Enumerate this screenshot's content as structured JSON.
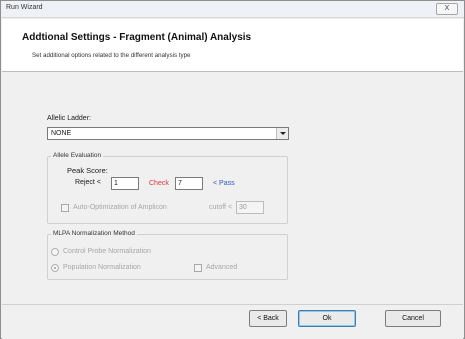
{
  "window": {
    "title": "Run Wizard",
    "close_label": "X"
  },
  "header": {
    "title": "Addtional Settings - Fragment (Animal) Analysis",
    "subtitle": "Set additional options related to the different analysis type"
  },
  "allelic_ladder": {
    "label": "Allelic Ladder:",
    "selected": "NONE"
  },
  "allele_evaluation": {
    "group_label": "Allele Evaluation",
    "peak_score_label": "Peak Score:",
    "reject_label": "Reject  <",
    "reject_value": "1",
    "check_label": "Check",
    "check_value": "7",
    "pass_label": "< Pass",
    "auto_label": "Auto-Optimization of Amplicon",
    "cutoff_label": "cutoff <",
    "cutoff_value": "30"
  },
  "mlpa": {
    "group_label": "MLPA Normalization Method",
    "option1": "Control Probe Normalization",
    "option2": "Population Normalization",
    "option3": "Advanced"
  },
  "footer": {
    "back_label": "< Back",
    "ok_label": "Ok",
    "cancel_label": "Cancel"
  },
  "colors": {
    "check": "#d63a3a",
    "pass": "#2d57c4"
  }
}
